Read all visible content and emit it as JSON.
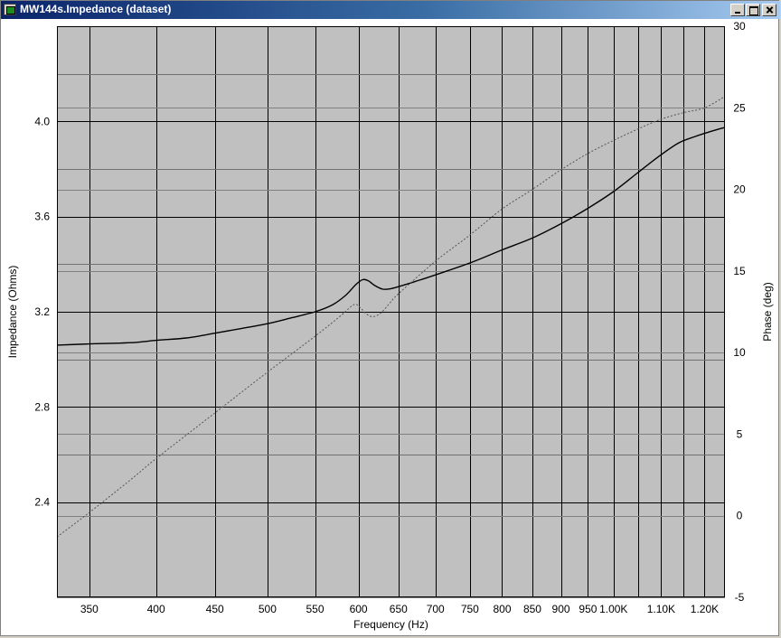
{
  "window": {
    "title": "MW144s.Impedance (dataset)",
    "icon": "app-icon",
    "buttons": [
      "minimize-icon",
      "maximize-icon",
      "close-icon"
    ]
  },
  "chart_data": {
    "type": "line",
    "title": "",
    "xlabel": "Frequency (Hz)",
    "ylabel": "Impedance (Ohms)",
    "y2label": "Phase (deg)",
    "x_scale": "log",
    "xlim": [
      328,
      1250
    ],
    "ylim": [
      2.0,
      4.4
    ],
    "y2lim": [
      -5,
      30
    ],
    "grid": true,
    "plot_background": "#c0c0c0",
    "x_ticks": [
      {
        "v": 350,
        "label": "350"
      },
      {
        "v": 400,
        "label": "400"
      },
      {
        "v": 450,
        "label": "450"
      },
      {
        "v": 500,
        "label": "500"
      },
      {
        "v": 550,
        "label": "550"
      },
      {
        "v": 600,
        "label": "600"
      },
      {
        "v": 650,
        "label": "650"
      },
      {
        "v": 700,
        "label": "700"
      },
      {
        "v": 750,
        "label": "750"
      },
      {
        "v": 800,
        "label": "800"
      },
      {
        "v": 850,
        "label": "850"
      },
      {
        "v": 900,
        "label": "900"
      },
      {
        "v": 950,
        "label": "950"
      },
      {
        "v": 1000,
        "label": "1.00K"
      },
      {
        "v": 1100,
        "label": "1.10K"
      },
      {
        "v": 1200,
        "label": "1.20K"
      }
    ],
    "x_minor_gridlines": [
      1050,
      1150
    ],
    "y_ticks": [
      {
        "v": 2.4,
        "label": "2.4"
      },
      {
        "v": 2.8,
        "label": "2.8"
      },
      {
        "v": 3.2,
        "label": "3.2"
      },
      {
        "v": 3.6,
        "label": "3.6"
      },
      {
        "v": 4.0,
        "label": "4.0"
      }
    ],
    "y_minor_gridlines": [
      2.0,
      2.6,
      3.0,
      3.4,
      3.8,
      4.2
    ],
    "y2_ticks": [
      {
        "v": -5,
        "label": "-5"
      },
      {
        "v": 0,
        "label": "0"
      },
      {
        "v": 5,
        "label": "5"
      },
      {
        "v": 10,
        "label": "10"
      },
      {
        "v": 15,
        "label": "15"
      },
      {
        "v": 20,
        "label": "20"
      },
      {
        "v": 25,
        "label": "25"
      },
      {
        "v": 30,
        "label": "30"
      }
    ],
    "series": [
      {
        "axis": "left",
        "style": "solid",
        "color": "#000000",
        "points": [
          [
            328,
            3.06
          ],
          [
            350,
            3.065
          ],
          [
            380,
            3.07
          ],
          [
            400,
            3.08
          ],
          [
            425,
            3.09
          ],
          [
            450,
            3.11
          ],
          [
            475,
            3.13
          ],
          [
            500,
            3.15
          ],
          [
            525,
            3.175
          ],
          [
            550,
            3.2
          ],
          [
            570,
            3.23
          ],
          [
            585,
            3.27
          ],
          [
            597,
            3.315
          ],
          [
            605,
            3.335
          ],
          [
            612,
            3.33
          ],
          [
            620,
            3.31
          ],
          [
            630,
            3.295
          ],
          [
            640,
            3.297
          ],
          [
            655,
            3.31
          ],
          [
            680,
            3.335
          ],
          [
            700,
            3.355
          ],
          [
            750,
            3.405
          ],
          [
            800,
            3.46
          ],
          [
            850,
            3.51
          ],
          [
            900,
            3.57
          ],
          [
            950,
            3.635
          ],
          [
            1000,
            3.705
          ],
          [
            1050,
            3.785
          ],
          [
            1100,
            3.86
          ],
          [
            1140,
            3.91
          ],
          [
            1175,
            3.935
          ],
          [
            1210,
            3.955
          ],
          [
            1250,
            3.975
          ]
        ]
      },
      {
        "axis": "right",
        "style": "dotted",
        "color": "#555555",
        "points": [
          [
            328,
            -1.3
          ],
          [
            350,
            0.2
          ],
          [
            380,
            2.2
          ],
          [
            400,
            3.5
          ],
          [
            450,
            6.3
          ],
          [
            500,
            8.8
          ],
          [
            550,
            11.0
          ],
          [
            580,
            12.3
          ],
          [
            595,
            12.95
          ],
          [
            603,
            12.7
          ],
          [
            610,
            12.35
          ],
          [
            618,
            12.2
          ],
          [
            628,
            12.45
          ],
          [
            640,
            13.1
          ],
          [
            650,
            13.6
          ],
          [
            700,
            15.6
          ],
          [
            750,
            17.2
          ],
          [
            800,
            18.8
          ],
          [
            850,
            20.0
          ],
          [
            900,
            21.2
          ],
          [
            950,
            22.2
          ],
          [
            1000,
            23.0
          ],
          [
            1050,
            23.7
          ],
          [
            1100,
            24.3
          ],
          [
            1150,
            24.7
          ],
          [
            1200,
            25.0
          ],
          [
            1250,
            25.7
          ]
        ]
      }
    ]
  }
}
